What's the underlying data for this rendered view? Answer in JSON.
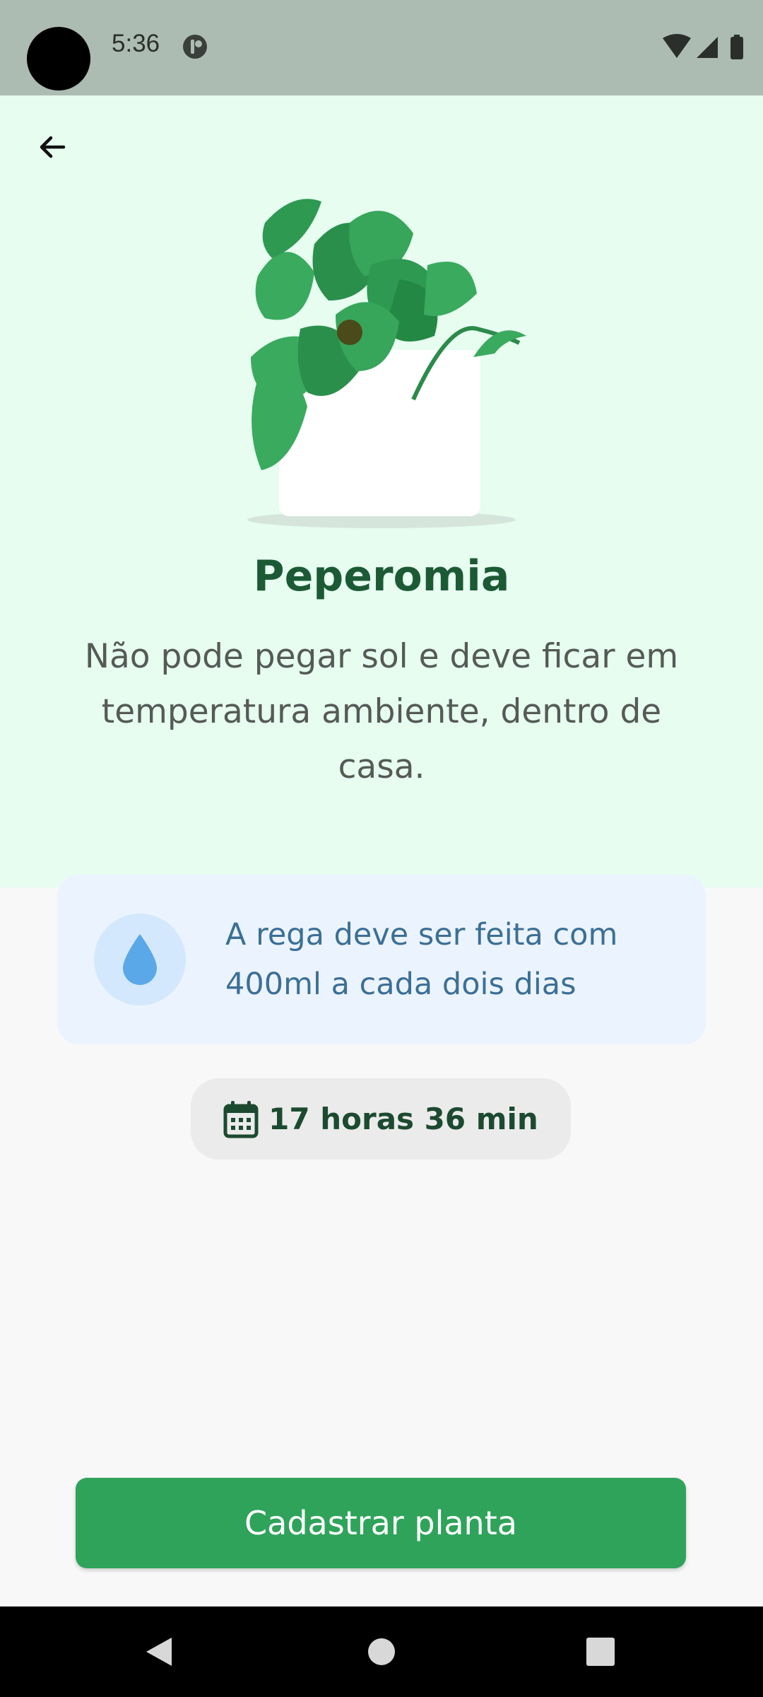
{
  "status_bar": {
    "time": "5:36",
    "icons": [
      "app-notification-icon",
      "wifi-icon",
      "cellular-signal-icon",
      "battery-icon"
    ]
  },
  "header": {
    "back_icon": "arrow-left-icon"
  },
  "plant": {
    "name": "Peperomia",
    "about": "Não pode pegar sol e deve ficar em temperatura ambiente, dentro de casa."
  },
  "water_tip": {
    "icon": "water-drop-icon",
    "text": "A rega deve ser feita com 400ml a cada dois dias"
  },
  "schedule": {
    "icon": "calendar-icon",
    "time_label": "17 horas 36 min"
  },
  "actions": {
    "submit_label": "Cadastrar planta"
  },
  "nav": {
    "items": [
      "back-triangle-icon",
      "home-circle-icon",
      "recents-square-icon"
    ]
  },
  "colors": {
    "hero_background": "#e6fdf0",
    "accent_green": "#2fa35a",
    "title_green": "#1c5a35",
    "water_card_bg": "#ebf4fe",
    "water_text": "#3c6f96"
  }
}
